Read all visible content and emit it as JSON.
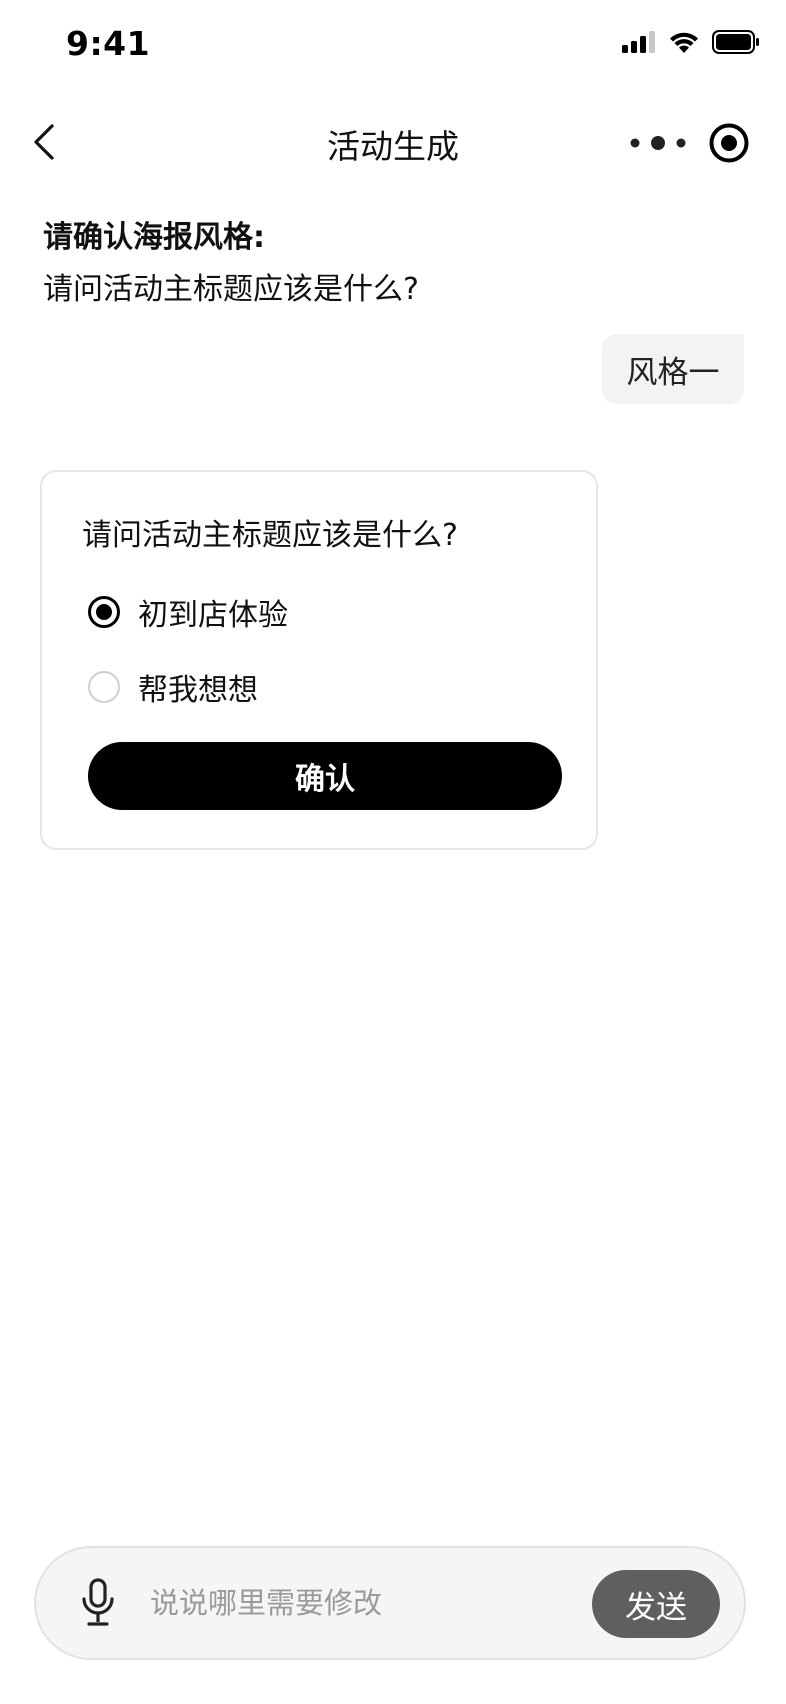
{
  "status_bar": {
    "time": "9:41"
  },
  "nav": {
    "title": "活动生成",
    "icons": [
      "back-arrow-icon",
      "more-dots-icon",
      "record-icon"
    ]
  },
  "bot_message": {
    "title": "请确认海报风格:",
    "question": "请问活动主标题应该是什么?"
  },
  "user_message": {
    "text": "风格一"
  },
  "question_card": {
    "question": "请问活动主标题应该是什么?",
    "options": [
      {
        "label": "初到店体验",
        "selected": true
      },
      {
        "label": "帮我想想",
        "selected": false
      }
    ],
    "confirm_label": "确认"
  },
  "input_bar": {
    "placeholder": "说说哪里需要修改",
    "value": "",
    "send_label": "发送"
  },
  "colors": {
    "primary_button": "#000000",
    "send_button": "#5f5f5f",
    "user_bubble": "#f2f3f5",
    "input_background": "#f4f5f7"
  }
}
